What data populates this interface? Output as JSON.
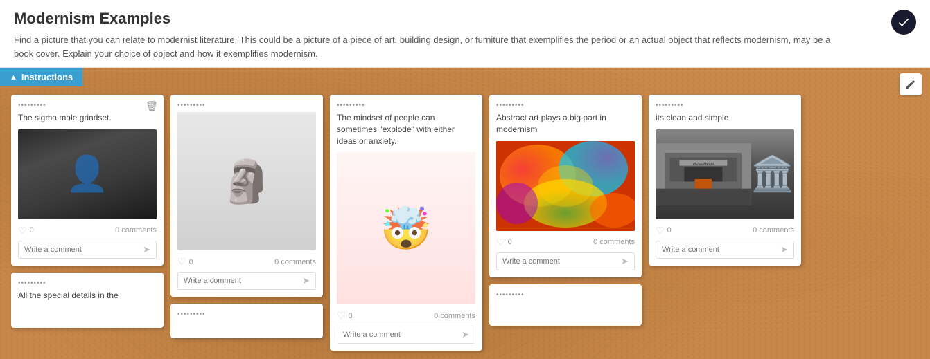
{
  "header": {
    "title": "Modernism Examples",
    "description": "Find a picture that you can relate to modernist literature. This could be a picture of a piece of art, building design, or furniture that exemplifies the period or an actual object that reflects modernism, may be a book cover. Explain your choice of object and how it exemplifies modernism.",
    "check_button_label": "✓"
  },
  "instructions_bar": {
    "label": "Instructions",
    "arrow": "▲"
  },
  "cards": [
    {
      "id": "card-1",
      "dots": "•••••••••",
      "text": "The sigma male grindset.",
      "has_image": true,
      "image_type": "batman",
      "likes": "0",
      "comments": "0 comments",
      "comment_placeholder": "Write a comment",
      "has_delete": true
    },
    {
      "id": "card-2",
      "dots": "•••••••••",
      "text": "",
      "has_image": true,
      "image_type": "sculpture",
      "likes": "0",
      "comments": "0 comments",
      "comment_placeholder": "Write a comment",
      "has_delete": false
    },
    {
      "id": "card-3",
      "dots": "•••••••••",
      "text": "The mindset of people can sometimes \"explode\" with either ideas or anxiety.",
      "has_image": true,
      "image_type": "explode",
      "likes": "0",
      "comments": "0 comments",
      "comment_placeholder": "Write a comment",
      "has_delete": false
    },
    {
      "id": "card-4",
      "dots": "•••••••••",
      "text": "Abstract art plays a big part in modernism",
      "has_image": true,
      "image_type": "abstract",
      "likes": "0",
      "comments": "0 comments",
      "comment_placeholder": "Write a comment",
      "has_delete": false
    },
    {
      "id": "card-5",
      "dots": "•••••••••",
      "text": "its clean and simple",
      "has_image": true,
      "image_type": "building",
      "likes": "0",
      "comments": "0 comments",
      "comment_placeholder": "Write a comment",
      "has_delete": false
    }
  ],
  "bottom_cards": [
    {
      "id": "card-b1",
      "dots": "•••••••••",
      "text": "All the special details in the"
    },
    {
      "id": "card-b2",
      "dots": "•••••••••",
      "text": ""
    }
  ],
  "colors": {
    "accent_blue": "#3b9ed0",
    "cork": "#c8874a",
    "dark_navy": "#1a1a2e"
  }
}
